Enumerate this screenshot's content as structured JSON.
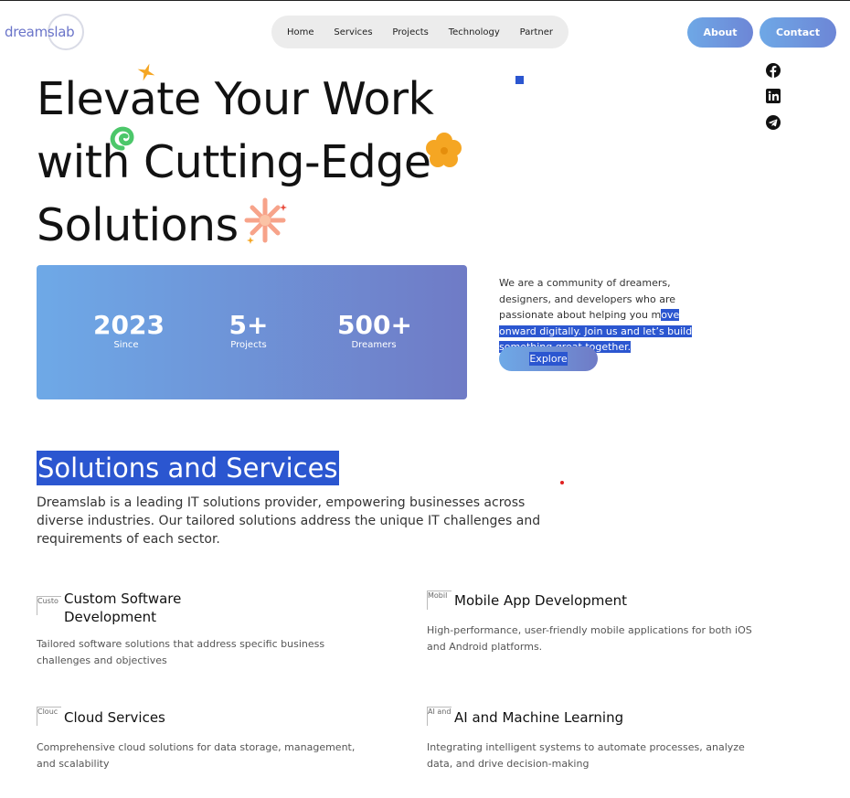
{
  "logo": {
    "text": "dreamslab"
  },
  "nav": {
    "items": [
      {
        "label": "Home"
      },
      {
        "label": "Services"
      },
      {
        "label": "Projects"
      },
      {
        "label": "Technology"
      },
      {
        "label": "Partner"
      }
    ]
  },
  "header": {
    "about_label": "About",
    "contact_label": "Contact"
  },
  "social": [
    "facebook-icon",
    "linkedin-icon",
    "telegram-icon"
  ],
  "hero": {
    "line1": "Elevate Your Work",
    "line2": "with Cutting-Edge",
    "line3": "Solutions"
  },
  "stats": [
    {
      "value": "2023",
      "label": "Since"
    },
    {
      "value": "5+",
      "label": "Projects"
    },
    {
      "value": "500+",
      "label": "Dreamers"
    }
  ],
  "about": {
    "text_plain": "We are a community of dreamers, designers, and developers who are passionate about helping you m",
    "text_selected": "ove onward digitally. Join us and let’s build something great together.",
    "explore_label": "Explore"
  },
  "section": {
    "title": "Solutions and Services",
    "subtitle": "Dreamslab is a leading IT solutions provider, empowering businesses across diverse industries. Our tailored solutions address the unique IT challenges and requirements of each sector."
  },
  "services": [
    {
      "img_alt": "Custo",
      "title": "Custom Software Development",
      "desc": "Tailored software solutions that address specific business challenges and objectives"
    },
    {
      "img_alt": "Mobil",
      "title": "Mobile App Development",
      "desc": "High-performance, user-friendly mobile applications for both iOS and Android platforms."
    },
    {
      "img_alt": "Clouc",
      "title": "Cloud Services",
      "desc": "Comprehensive cloud solutions for data storage, management, and scalability"
    },
    {
      "img_alt": "AI and",
      "title": "AI and Machine Learning",
      "desc": "Integrating intelligent systems to automate processes, analyze data, and drive decision-making"
    }
  ],
  "colors": {
    "accent": "#2b56d0",
    "gradient_start": "#6ea9e7",
    "gradient_end": "#6f7bc6",
    "orange": "#f5a623",
    "green": "#4cc76a"
  }
}
